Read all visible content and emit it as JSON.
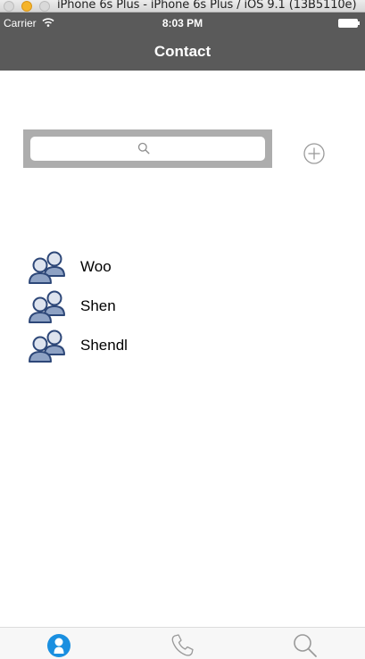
{
  "window": {
    "title": "iPhone 6s Plus - iPhone 6s Plus / iOS 9.1 (13B5110e)"
  },
  "status_bar": {
    "carrier": "Carrier",
    "time": "8:03 PM"
  },
  "nav": {
    "title": "Contact"
  },
  "search": {
    "placeholder": "",
    "value": ""
  },
  "contacts": [
    {
      "name": "Woo"
    },
    {
      "name": "Shen"
    },
    {
      "name": "Shendl"
    }
  ],
  "tabs": [
    {
      "icon": "contacts-icon",
      "selected": true
    },
    {
      "icon": "phone-icon",
      "selected": false
    },
    {
      "icon": "search-icon",
      "selected": false
    }
  ],
  "colors": {
    "nav_background": "#5a5a5a",
    "tab_selected": "#1a8fe0",
    "tab_unselected": "#9a9a9a",
    "avatar_fill": "#8ea2c4",
    "avatar_stroke": "#2d4778"
  }
}
